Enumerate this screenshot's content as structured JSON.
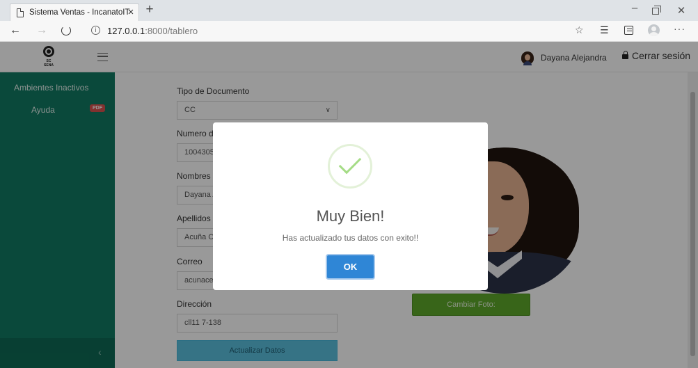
{
  "browser": {
    "tab_title": "Sistema Ventas - IncanatoIT",
    "url_host": "127.0.0.1",
    "url_path": ":8000/tablero"
  },
  "header": {
    "logo_text": "SC SENA",
    "user_name": "Dayana Alejandra",
    "logout_label": "Cerrar sesión"
  },
  "sidebar": {
    "items": [
      {
        "label": "Ambientes Inactivos"
      },
      {
        "label": "Ayuda",
        "badge": "PDF"
      }
    ]
  },
  "form": {
    "tipo_documento": {
      "label": "Tipo de Documento",
      "value": "CC"
    },
    "numero_documento": {
      "label": "Numero de Documento",
      "value": "1004305"
    },
    "nombres": {
      "label": "Nombres",
      "value": "Dayana A"
    },
    "apellidos": {
      "label": "Apellidos",
      "value": "Acuña Ce"
    },
    "correo": {
      "label": "Correo",
      "value": "acunaced"
    },
    "direccion": {
      "label": "Dirección",
      "value": "cll11 7-138"
    },
    "update_button": "Actualizar Datos",
    "change_photo_button": "Cambiar Foto:"
  },
  "modal": {
    "title": "Muy Bien!",
    "message": "Has actualizado tus datos con exito!!",
    "ok_label": "OK",
    "icon": "success-check-icon"
  },
  "colors": {
    "sidebar": "#117a63",
    "success": "#a5dc86",
    "ok_button": "#2f86d6",
    "change_photo": "#5ea82a",
    "update_button": "#5bc0de"
  }
}
